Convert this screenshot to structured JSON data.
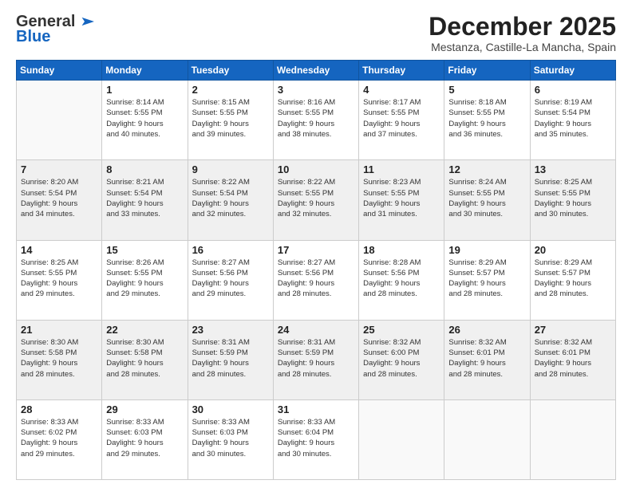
{
  "logo": {
    "line1": "General",
    "line2": "Blue"
  },
  "header": {
    "month": "December 2025",
    "location": "Mestanza, Castille-La Mancha, Spain"
  },
  "days": [
    "Sunday",
    "Monday",
    "Tuesday",
    "Wednesday",
    "Thursday",
    "Friday",
    "Saturday"
  ],
  "weeks": [
    [
      {
        "day": "",
        "info": ""
      },
      {
        "day": "1",
        "info": "Sunrise: 8:14 AM\nSunset: 5:55 PM\nDaylight: 9 hours\nand 40 minutes."
      },
      {
        "day": "2",
        "info": "Sunrise: 8:15 AM\nSunset: 5:55 PM\nDaylight: 9 hours\nand 39 minutes."
      },
      {
        "day": "3",
        "info": "Sunrise: 8:16 AM\nSunset: 5:55 PM\nDaylight: 9 hours\nand 38 minutes."
      },
      {
        "day": "4",
        "info": "Sunrise: 8:17 AM\nSunset: 5:55 PM\nDaylight: 9 hours\nand 37 minutes."
      },
      {
        "day": "5",
        "info": "Sunrise: 8:18 AM\nSunset: 5:55 PM\nDaylight: 9 hours\nand 36 minutes."
      },
      {
        "day": "6",
        "info": "Sunrise: 8:19 AM\nSunset: 5:54 PM\nDaylight: 9 hours\nand 35 minutes."
      }
    ],
    [
      {
        "day": "7",
        "info": "Sunrise: 8:20 AM\nSunset: 5:54 PM\nDaylight: 9 hours\nand 34 minutes."
      },
      {
        "day": "8",
        "info": "Sunrise: 8:21 AM\nSunset: 5:54 PM\nDaylight: 9 hours\nand 33 minutes."
      },
      {
        "day": "9",
        "info": "Sunrise: 8:22 AM\nSunset: 5:54 PM\nDaylight: 9 hours\nand 32 minutes."
      },
      {
        "day": "10",
        "info": "Sunrise: 8:22 AM\nSunset: 5:55 PM\nDaylight: 9 hours\nand 32 minutes."
      },
      {
        "day": "11",
        "info": "Sunrise: 8:23 AM\nSunset: 5:55 PM\nDaylight: 9 hours\nand 31 minutes."
      },
      {
        "day": "12",
        "info": "Sunrise: 8:24 AM\nSunset: 5:55 PM\nDaylight: 9 hours\nand 30 minutes."
      },
      {
        "day": "13",
        "info": "Sunrise: 8:25 AM\nSunset: 5:55 PM\nDaylight: 9 hours\nand 30 minutes."
      }
    ],
    [
      {
        "day": "14",
        "info": "Sunrise: 8:25 AM\nSunset: 5:55 PM\nDaylight: 9 hours\nand 29 minutes."
      },
      {
        "day": "15",
        "info": "Sunrise: 8:26 AM\nSunset: 5:55 PM\nDaylight: 9 hours\nand 29 minutes."
      },
      {
        "day": "16",
        "info": "Sunrise: 8:27 AM\nSunset: 5:56 PM\nDaylight: 9 hours\nand 29 minutes."
      },
      {
        "day": "17",
        "info": "Sunrise: 8:27 AM\nSunset: 5:56 PM\nDaylight: 9 hours\nand 28 minutes."
      },
      {
        "day": "18",
        "info": "Sunrise: 8:28 AM\nSunset: 5:56 PM\nDaylight: 9 hours\nand 28 minutes."
      },
      {
        "day": "19",
        "info": "Sunrise: 8:29 AM\nSunset: 5:57 PM\nDaylight: 9 hours\nand 28 minutes."
      },
      {
        "day": "20",
        "info": "Sunrise: 8:29 AM\nSunset: 5:57 PM\nDaylight: 9 hours\nand 28 minutes."
      }
    ],
    [
      {
        "day": "21",
        "info": "Sunrise: 8:30 AM\nSunset: 5:58 PM\nDaylight: 9 hours\nand 28 minutes."
      },
      {
        "day": "22",
        "info": "Sunrise: 8:30 AM\nSunset: 5:58 PM\nDaylight: 9 hours\nand 28 minutes."
      },
      {
        "day": "23",
        "info": "Sunrise: 8:31 AM\nSunset: 5:59 PM\nDaylight: 9 hours\nand 28 minutes."
      },
      {
        "day": "24",
        "info": "Sunrise: 8:31 AM\nSunset: 5:59 PM\nDaylight: 9 hours\nand 28 minutes."
      },
      {
        "day": "25",
        "info": "Sunrise: 8:32 AM\nSunset: 6:00 PM\nDaylight: 9 hours\nand 28 minutes."
      },
      {
        "day": "26",
        "info": "Sunrise: 8:32 AM\nSunset: 6:01 PM\nDaylight: 9 hours\nand 28 minutes."
      },
      {
        "day": "27",
        "info": "Sunrise: 8:32 AM\nSunset: 6:01 PM\nDaylight: 9 hours\nand 28 minutes."
      }
    ],
    [
      {
        "day": "28",
        "info": "Sunrise: 8:33 AM\nSunset: 6:02 PM\nDaylight: 9 hours\nand 29 minutes."
      },
      {
        "day": "29",
        "info": "Sunrise: 8:33 AM\nSunset: 6:03 PM\nDaylight: 9 hours\nand 29 minutes."
      },
      {
        "day": "30",
        "info": "Sunrise: 8:33 AM\nSunset: 6:03 PM\nDaylight: 9 hours\nand 30 minutes."
      },
      {
        "day": "31",
        "info": "Sunrise: 8:33 AM\nSunset: 6:04 PM\nDaylight: 9 hours\nand 30 minutes."
      },
      {
        "day": "",
        "info": ""
      },
      {
        "day": "",
        "info": ""
      },
      {
        "day": "",
        "info": ""
      }
    ]
  ]
}
